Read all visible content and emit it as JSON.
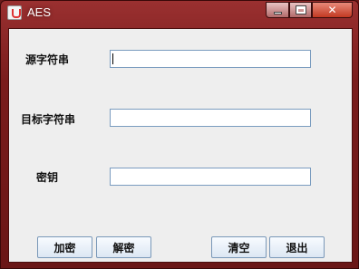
{
  "window": {
    "title": "AES"
  },
  "form": {
    "source_label": "源字符串",
    "target_label": "目标字符串",
    "key_label": "密钥",
    "source_value": "",
    "target_value": "",
    "key_value": ""
  },
  "buttons": {
    "encrypt": "加密",
    "decrypt": "解密",
    "clear": "清空",
    "exit": "退出"
  }
}
